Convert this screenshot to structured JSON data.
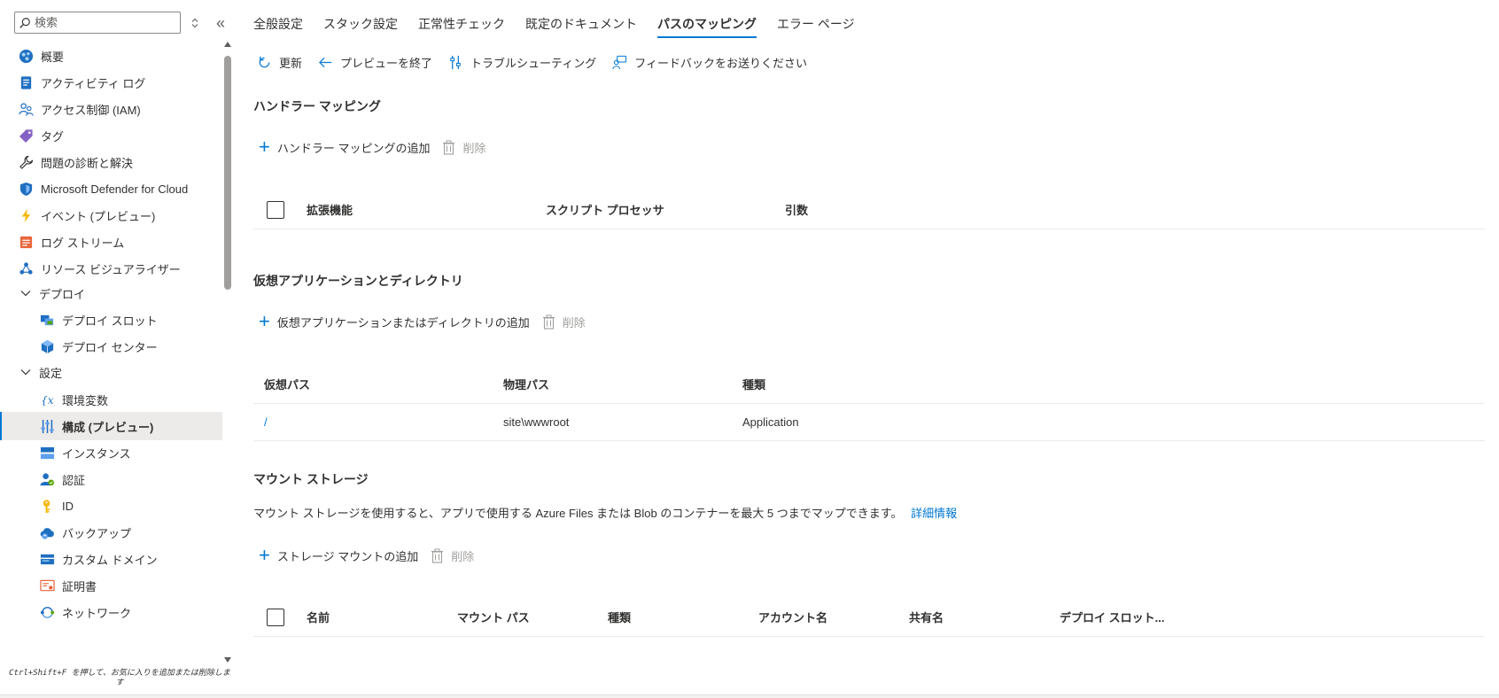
{
  "sidebar": {
    "search_placeholder": "検索",
    "items": [
      {
        "label": "概要",
        "icon": "overview-icon"
      },
      {
        "label": "アクティビティ ログ",
        "icon": "activity-log-icon"
      },
      {
        "label": "アクセス制御 (IAM)",
        "icon": "iam-icon"
      },
      {
        "label": "タグ",
        "icon": "tag-icon"
      },
      {
        "label": "問題の診断と解決",
        "icon": "wrench-icon"
      },
      {
        "label": "Microsoft Defender for Cloud",
        "icon": "defender-shield-icon"
      },
      {
        "label": "イベント (プレビュー)",
        "icon": "lightning-icon"
      },
      {
        "label": "ログ ストリーム",
        "icon": "log-stream-icon"
      },
      {
        "label": "リソース ビジュアライザー",
        "icon": "resource-visualizer-icon"
      },
      {
        "label": "デプロイ",
        "icon": "chevron-down-icon"
      },
      {
        "label": "デプロイ スロット",
        "icon": "deployment-slots-icon"
      },
      {
        "label": "デプロイ センター",
        "icon": "deployment-center-icon"
      },
      {
        "label": "設定",
        "icon": "chevron-down-icon"
      },
      {
        "label": "環境変数",
        "icon": "environment-variables-icon"
      },
      {
        "label": "構成 (プレビュー)",
        "icon": "configuration-icon"
      },
      {
        "label": "インスタンス",
        "icon": "instances-icon"
      },
      {
        "label": "認証",
        "icon": "authentication-icon"
      },
      {
        "label": "ID",
        "icon": "identity-key-icon"
      },
      {
        "label": "バックアップ",
        "icon": "backup-cloud-icon"
      },
      {
        "label": "カスタム ドメイン",
        "icon": "custom-domain-icon"
      },
      {
        "label": "証明書",
        "icon": "certificate-icon"
      },
      {
        "label": "ネットワーク",
        "icon": "network-icon"
      }
    ],
    "hint": "Ctrl+Shift+F を押して、お気に入りを追加または削除します"
  },
  "tabs": [
    {
      "label": "全般設定"
    },
    {
      "label": "スタック設定"
    },
    {
      "label": "正常性チェック"
    },
    {
      "label": "既定のドキュメント"
    },
    {
      "label": "パスのマッピング"
    },
    {
      "label": "エラー ページ"
    }
  ],
  "toolbar": {
    "refresh": "更新",
    "exit_preview": "プレビューを終了",
    "troubleshoot": "トラブルシューティング",
    "feedback": "フィードバックをお送りください"
  },
  "handler": {
    "title": "ハンドラー マッピング",
    "add": "ハンドラー マッピングの追加",
    "delete": "削除",
    "columns": [
      "拡張機能",
      "スクリプト プロセッサ",
      "引数"
    ]
  },
  "virtual": {
    "title": "仮想アプリケーションとディレクトリ",
    "add": "仮想アプリケーションまたはディレクトリの追加",
    "delete": "削除",
    "columns": [
      "仮想パス",
      "物理パス",
      "種類"
    ],
    "rows": [
      {
        "virtual_path": "/",
        "physical_path": "site\\wwwroot",
        "type": "Application"
      }
    ]
  },
  "mount": {
    "title": "マウント ストレージ",
    "description": "マウント ストレージを使用すると、アプリで使用する Azure Files または Blob のコンテナーを最大 5 つまでマップできます。",
    "learn_more": "詳細情報",
    "add": "ストレージ マウントの追加",
    "delete": "削除",
    "columns": [
      "名前",
      "マウント パス",
      "種類",
      "アカウント名",
      "共有名",
      "デプロイ スロット..."
    ]
  },
  "colors": {
    "accent": "#0078d4",
    "selected_bg": "#edebe9",
    "disabled": "#a19f9d"
  }
}
